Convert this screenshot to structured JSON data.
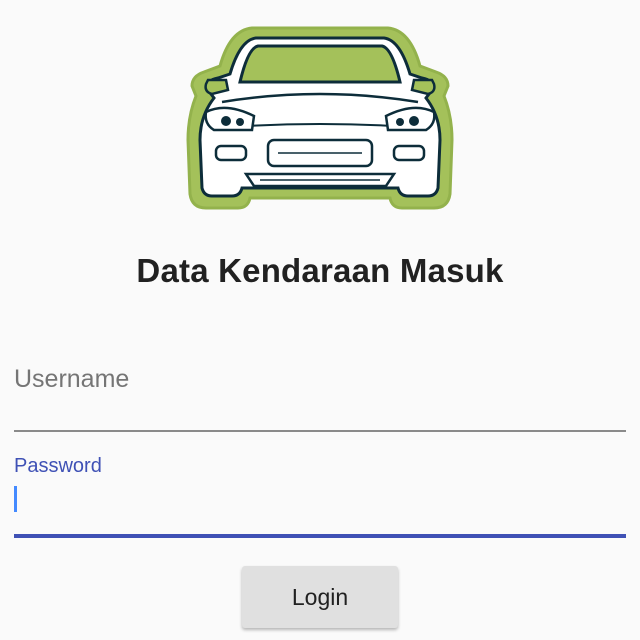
{
  "header": {
    "logo_icon": "car-front-icon",
    "title": "Data Kendaraan Masuk"
  },
  "form": {
    "username": {
      "placeholder": "Username",
      "value": ""
    },
    "password": {
      "label": "Password",
      "value": ""
    },
    "login_label": "Login"
  },
  "colors": {
    "background": "#fafafa",
    "accent": "#3f51b5",
    "cursor": "#448aff",
    "logo_green": "#a4c15a",
    "button": "#e0e0e0"
  }
}
